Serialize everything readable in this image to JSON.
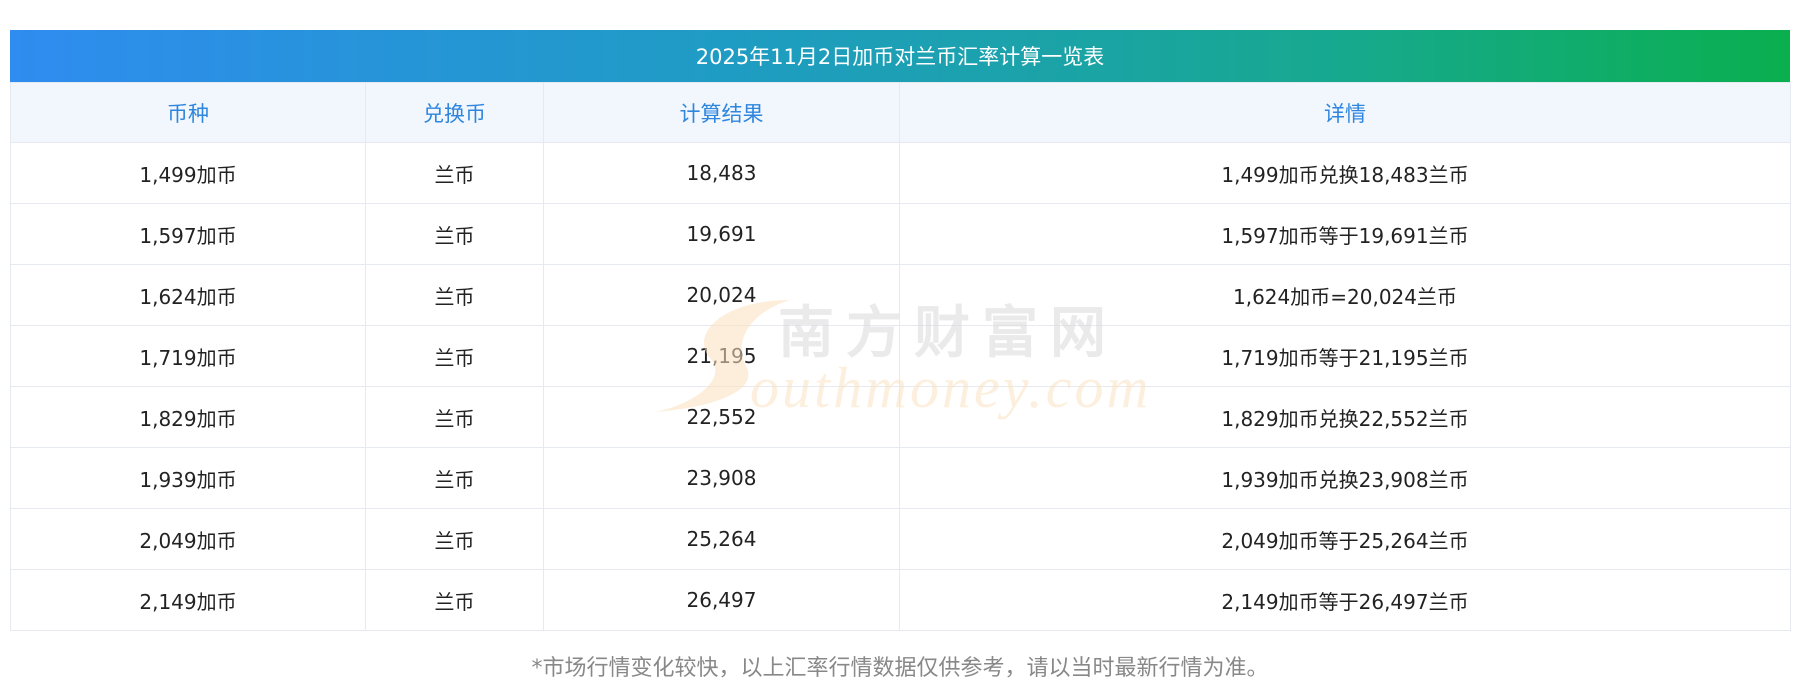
{
  "title": "2025年11月2日加币对兰币汇率计算一览表",
  "headers": [
    "币种",
    "兑换币",
    "计算结果",
    "详情"
  ],
  "rows": [
    [
      "1,499加币",
      "兰币",
      "18,483",
      "1,499加币兑换18,483兰币"
    ],
    [
      "1,597加币",
      "兰币",
      "19,691",
      "1,597加币等于19,691兰币"
    ],
    [
      "1,624加币",
      "兰币",
      "20,024",
      "1,624加币=20,024兰币"
    ],
    [
      "1,719加币",
      "兰币",
      "21,195",
      "1,719加币等于21,195兰币"
    ],
    [
      "1,829加币",
      "兰币",
      "22,552",
      "1,829加币兑换22,552兰币"
    ],
    [
      "1,939加币",
      "兰币",
      "23,908",
      "1,939加币兑换23,908兰币"
    ],
    [
      "2,049加币",
      "兰币",
      "25,264",
      "2,049加币等于25,264兰币"
    ],
    [
      "2,149加币",
      "兰币",
      "26,497",
      "2,149加币等于26,497兰币"
    ]
  ],
  "footnote": "*市场行情变化较快，以上汇率行情数据仅供参考，请以当时最新行情为准。",
  "watermark": {
    "cn": "南方财富网",
    "en": "outhmoney.com"
  },
  "colors": {
    "title_gradient_start": "#2f8cf0",
    "title_gradient_end": "#0aaf4f",
    "header_text": "#2e86de",
    "header_bg": "#f2f7fd",
    "footnote_text": "#888888"
  }
}
